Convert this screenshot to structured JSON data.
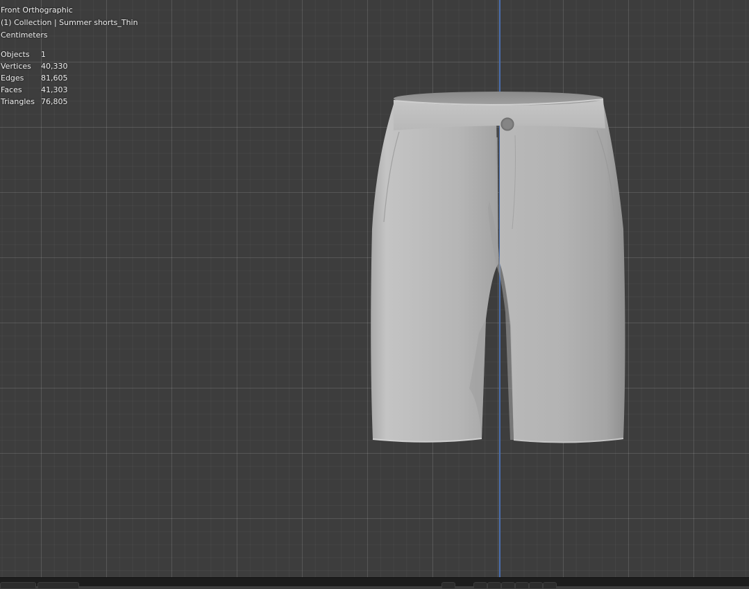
{
  "viewport": {
    "view_name": "Front Orthographic",
    "collection_line": "(1) Collection | Summer shorts_Thin",
    "units": "Centimeters",
    "grid_color": "#3d3d3d",
    "axis_color": "#4a6fb0"
  },
  "stats": [
    {
      "label": "Objects",
      "value": "1"
    },
    {
      "label": "Vertices",
      "value": "40,330"
    },
    {
      "label": "Edges",
      "value": "81,605"
    },
    {
      "label": "Faces",
      "value": "41,303"
    },
    {
      "label": "Triangles",
      "value": "76,805"
    }
  ],
  "model": {
    "name": "summer-shorts",
    "color": "#b4b4b4"
  }
}
